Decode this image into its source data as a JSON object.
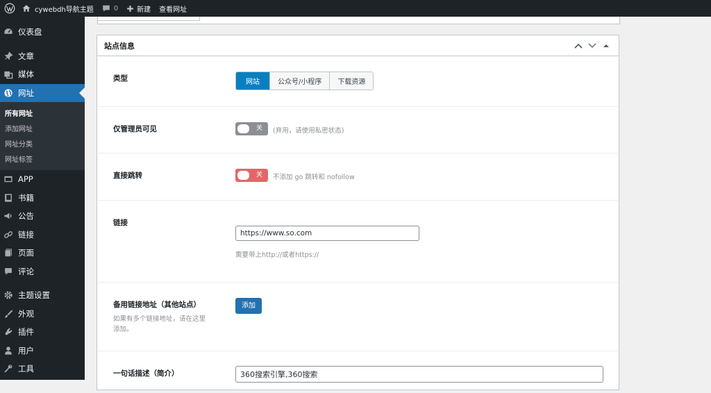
{
  "adminbar": {
    "site_name": "cywebdh导航主题",
    "comment_count": "0",
    "new_label": "新建",
    "view_label": "查看网址"
  },
  "sidebar": {
    "items": [
      {
        "label": "仪表盘",
        "icon": "dashboard-icon"
      },
      {
        "label": "文章",
        "icon": "pin-icon"
      },
      {
        "label": "媒体",
        "icon": "media-icon"
      },
      {
        "label": "网址",
        "icon": "globe-icon",
        "current": true
      },
      {
        "label": "APP",
        "icon": "app-icon"
      },
      {
        "label": "书籍",
        "icon": "book-icon"
      },
      {
        "label": "公告",
        "icon": "megaphone-icon"
      },
      {
        "label": "链接",
        "icon": "link-icon"
      },
      {
        "label": "页面",
        "icon": "page-icon"
      },
      {
        "label": "评论",
        "icon": "comment-icon"
      },
      {
        "label": "主题设置",
        "icon": "gear-icon"
      },
      {
        "label": "外观",
        "icon": "brush-icon"
      },
      {
        "label": "插件",
        "icon": "plugin-icon"
      },
      {
        "label": "用户",
        "icon": "user-icon"
      },
      {
        "label": "工具",
        "icon": "wrench-icon"
      }
    ],
    "submenu": [
      "所有网址",
      "添加网址",
      "网址分类",
      "网址标签"
    ]
  },
  "postbox": {
    "title": "站点信息",
    "type_label": "类型",
    "type_options": [
      "网站",
      "公众号/小程序",
      "下载资源"
    ],
    "type_selected": "网站",
    "admin_only_label": "仅管理员可见",
    "admin_only_state": "关",
    "admin_only_note": "(弃用，请使用私密状态)",
    "redirect_label": "直接跳转",
    "redirect_state": "关",
    "redirect_note": "不添加 go 跳转和 nofollow",
    "link_label": "链接",
    "link_value": "https://www.so.com",
    "link_hint": "需要带上http://或者https://",
    "backup_label": "备用链接地址（其他站点）",
    "backup_desc": "如果有多个链接地址，请在这里添加。",
    "add_button": "添加",
    "desc_label": "一句话描述（简介）",
    "desc_value": "360搜索引擎,360搜索"
  },
  "colors": {
    "accent": "#2271b1",
    "segment_active": "#0a7fc0",
    "toggle_off_gray": "#8c8f94",
    "toggle_off_red": "#e26868"
  }
}
